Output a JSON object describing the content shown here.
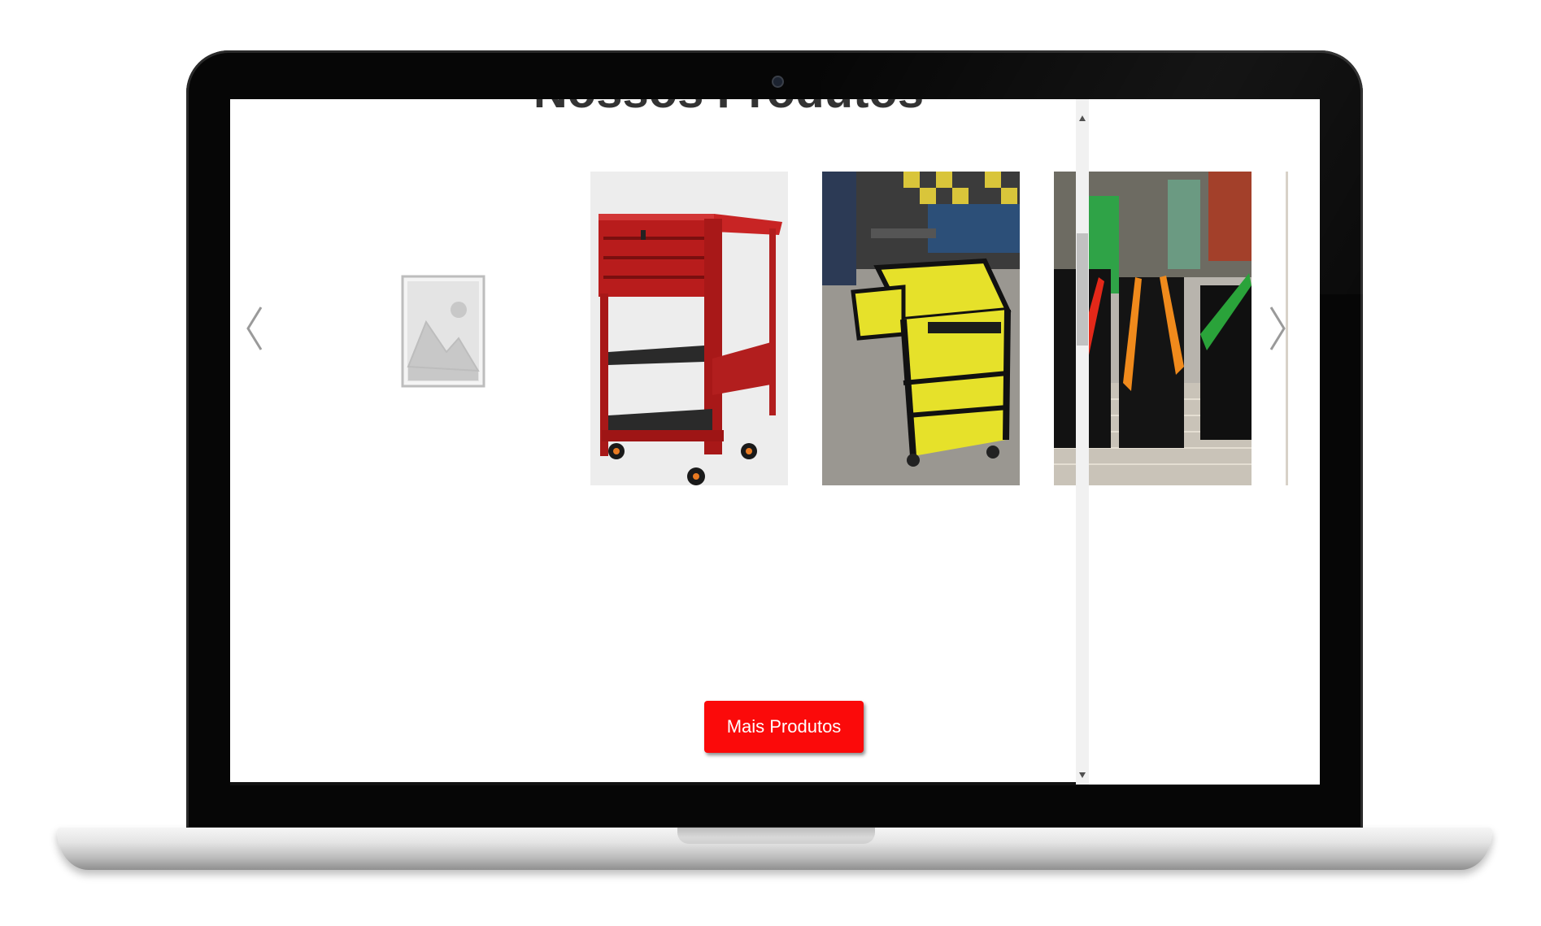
{
  "section": {
    "title": "Nossos Produtos"
  },
  "carousel": {
    "prev_icon": "chevron-left-icon",
    "next_icon": "chevron-right-icon",
    "placeholder_icon": "image-placeholder-icon",
    "products": [
      {
        "image": "red-tool-cart"
      },
      {
        "image": "yellow-black-tool-cart"
      },
      {
        "image": "cantilever-toolboxes"
      }
    ]
  },
  "actions": {
    "more_label": "Mais Produtos",
    "accent_color": "#fb0a0a"
  }
}
